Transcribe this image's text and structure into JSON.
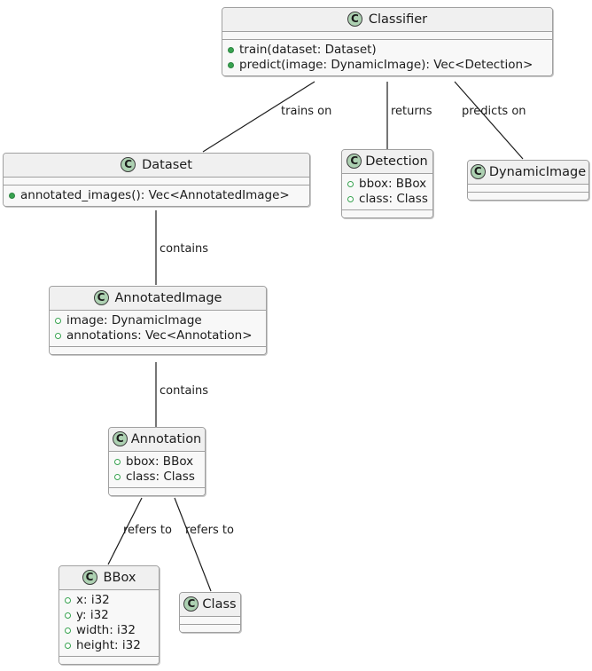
{
  "diagram": {
    "type": "uml-class-diagram",
    "title": "Classifier UML class diagram",
    "colors": {
      "class_icon_fill": "#ADD1B2",
      "class_icon_border": "#3c3c3c",
      "box_border": "#a0a0a0",
      "header_fill": "#f0f0f0",
      "body_fill": "#f8f8f8",
      "member_marker_public": "#38a350",
      "line": "#000000",
      "text": "#1c1c1c",
      "background": "#ffffff"
    },
    "classes": [
      {
        "id": "classifier",
        "icon": "class-icon-C",
        "name": "Classifier",
        "fields": [],
        "methods": [
          {
            "marker": "public-method",
            "text": "train(dataset: Dataset)"
          },
          {
            "marker": "public-method",
            "text": "predict(image: DynamicImage): Vec<Detection>"
          }
        ],
        "has_empty_trailing_compartment": false
      },
      {
        "id": "dataset",
        "icon": "class-icon-C",
        "name": "Dataset",
        "fields": [],
        "methods": [
          {
            "marker": "public-method",
            "text": "annotated_images(): Vec<AnnotatedImage>"
          }
        ],
        "has_empty_trailing_compartment": false
      },
      {
        "id": "detection",
        "icon": "class-icon-C",
        "name": "Detection",
        "fields": [
          {
            "marker": "field",
            "text": "bbox: BBox"
          },
          {
            "marker": "field",
            "text": "class: Class"
          }
        ],
        "methods": [],
        "has_empty_trailing_compartment": true
      },
      {
        "id": "dynamicimage",
        "icon": "class-icon-C",
        "name": "DynamicImage",
        "fields": [],
        "methods": [],
        "has_empty_trailing_compartment": true
      },
      {
        "id": "annotatedimage",
        "icon": "class-icon-C",
        "name": "AnnotatedImage",
        "fields": [
          {
            "marker": "field",
            "text": "image: DynamicImage"
          },
          {
            "marker": "field",
            "text": "annotations: Vec<Annotation>"
          }
        ],
        "methods": [],
        "has_empty_trailing_compartment": true
      },
      {
        "id": "annotation",
        "icon": "class-icon-C",
        "name": "Annotation",
        "fields": [
          {
            "marker": "field",
            "text": "bbox: BBox"
          },
          {
            "marker": "field",
            "text": "class: Class"
          }
        ],
        "methods": [],
        "has_empty_trailing_compartment": true
      },
      {
        "id": "bbox",
        "icon": "class-icon-C",
        "name": "BBox",
        "fields": [
          {
            "marker": "field",
            "text": "x: i32"
          },
          {
            "marker": "field",
            "text": "y: i32"
          },
          {
            "marker": "field",
            "text": "width: i32"
          },
          {
            "marker": "field",
            "text": "height: i32"
          }
        ],
        "methods": [],
        "has_empty_trailing_compartment": true
      },
      {
        "id": "class",
        "icon": "class-icon-C",
        "name": "Class",
        "fields": [],
        "methods": [],
        "has_empty_trailing_compartment": true
      }
    ],
    "relationships": [
      {
        "id": "trains-on",
        "from": "classifier",
        "to": "dataset",
        "label": "trains on"
      },
      {
        "id": "returns",
        "from": "classifier",
        "to": "detection",
        "label": "returns"
      },
      {
        "id": "predicts-on",
        "from": "classifier",
        "to": "dynamicimage",
        "label": "predicts on"
      },
      {
        "id": "dataset-contains",
        "from": "dataset",
        "to": "annotatedimage",
        "label": "contains"
      },
      {
        "id": "image-contains",
        "from": "annotatedimage",
        "to": "annotation",
        "label": "contains"
      },
      {
        "id": "refers-to-bbox",
        "from": "annotation",
        "to": "bbox",
        "label": "refers to"
      },
      {
        "id": "refers-to-class",
        "from": "annotation",
        "to": "class",
        "label": "refers to"
      }
    ]
  }
}
